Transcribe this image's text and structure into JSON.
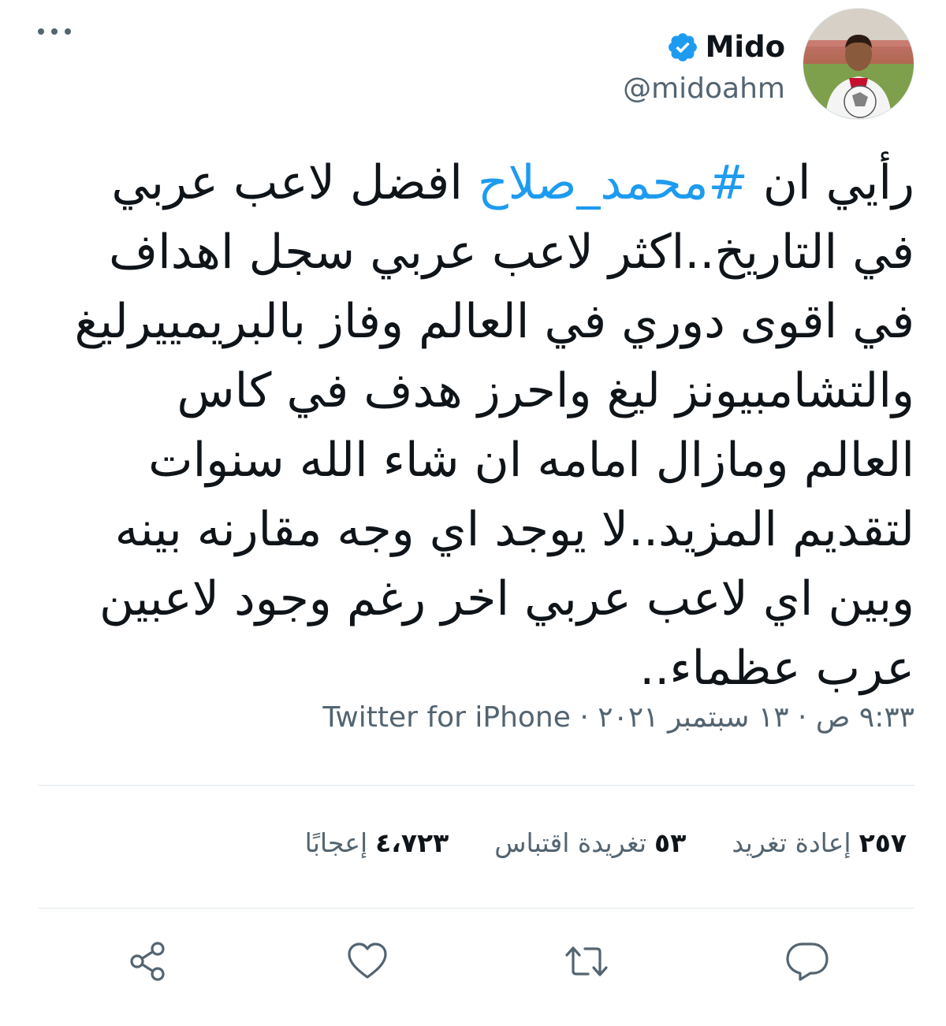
{
  "author": {
    "display_name": "Mido",
    "handle": "@midoahm",
    "verified": true
  },
  "tweet": {
    "text_before": "رأيي ان ",
    "hashtag": "#محمد_صلاح",
    "text_after": " افضل لاعب عربي في التاريخ..اكثر لاعب عربي سجل اهداف في اقوى دوري في العالم وفاز بالبريمييرليغ والتشامبيونز ليغ واحرز هدف في كاس العالم ومازال امامه ان شاء الله سنوات لتقديم المزيد..لا يوجد اي وجه مقارنه بينه وبين اي لاعب عربي اخر رغم وجود لاعبين عرب عظماء..",
    "timestamp": "٩:٣٣ ص · ١٣ سبتمبر ٢٠٢١ · ",
    "source": "Twitter for iPhone"
  },
  "stats": {
    "retweets_count": "٢٥٧",
    "retweets_label": "إعادة تغريد",
    "quotes_count": "٥٣",
    "quotes_label": "تغريدة اقتباس",
    "likes_count": "٤،٧٢٣",
    "likes_label": "إعجابًا"
  },
  "icons": {
    "more": "more-dots-icon",
    "verified": "verified-badge-icon",
    "reply": "reply-icon",
    "retweet": "retweet-icon",
    "like": "heart-icon",
    "share": "share-icon"
  },
  "colors": {
    "accent": "#1d9bf0",
    "text": "#0f1419",
    "secondary": "#536471",
    "divider": "#e1e8ed"
  }
}
